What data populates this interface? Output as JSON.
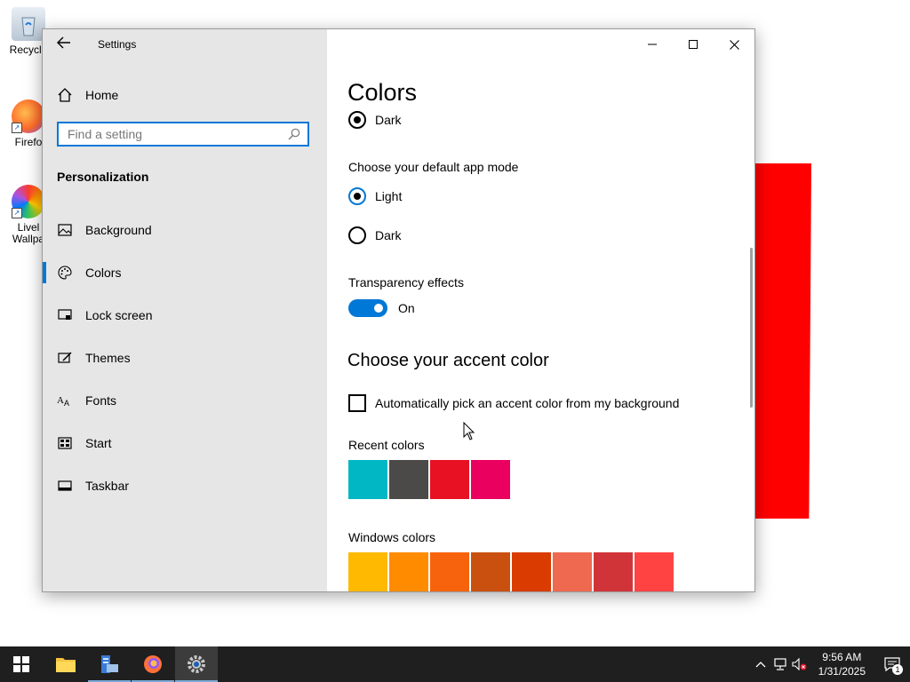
{
  "desktop": {
    "icons": [
      {
        "label": "Recycle",
        "icon": "recycle-bin-icon"
      },
      {
        "label": "Firefo",
        "icon": "firefox-icon"
      },
      {
        "label": "Livel Wallpa",
        "icon": "lively-wallpaper-icon"
      }
    ]
  },
  "window": {
    "title": "Settings",
    "controls": {
      "minimize": "minimize-icon",
      "maximize": "maximize-icon",
      "close": "close-icon"
    }
  },
  "sidebar": {
    "home_label": "Home",
    "search_placeholder": "Find a setting",
    "section": "Personalization",
    "items": [
      {
        "label": "Background",
        "icon": "picture-icon",
        "active": false
      },
      {
        "label": "Colors",
        "icon": "palette-icon",
        "active": true
      },
      {
        "label": "Lock screen",
        "icon": "lock-screen-icon",
        "active": false
      },
      {
        "label": "Themes",
        "icon": "themes-icon",
        "active": false
      },
      {
        "label": "Fonts",
        "icon": "fonts-icon",
        "active": false
      },
      {
        "label": "Start",
        "icon": "start-icon",
        "active": false
      },
      {
        "label": "Taskbar",
        "icon": "taskbar-icon",
        "active": false
      }
    ]
  },
  "content": {
    "page_title": "Colors",
    "windows_mode_selected": "Dark",
    "app_mode": {
      "label": "Choose your default app mode",
      "options": [
        "Light",
        "Dark"
      ],
      "selected": "Light"
    },
    "transparency": {
      "label": "Transparency effects",
      "state": "On"
    },
    "accent": {
      "title": "Choose your accent color",
      "auto_pick_label": "Automatically pick an accent color from my background",
      "recent_label": "Recent colors",
      "recent_colors": [
        "#00b7c3",
        "#4c4a48",
        "#e81123",
        "#ea005e"
      ],
      "windows_label": "Windows colors",
      "windows_colors": [
        "#ffb900",
        "#ff8c00",
        "#f7630c",
        "#ca5010",
        "#da3b01",
        "#ef6950",
        "#d13438",
        "#ff4343"
      ]
    }
  },
  "taskbar": {
    "clock_time": "9:56 AM",
    "clock_date": "1/31/2025",
    "notification_count": "1",
    "accent": "#0078d7"
  }
}
